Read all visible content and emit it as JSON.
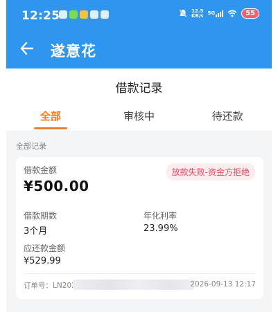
{
  "status_bar": {
    "time": "12:25",
    "net_speed_value": "12.5",
    "net_speed_unit": "KB/s",
    "network": "5G",
    "battery": "55"
  },
  "app_bar": {
    "title": "遂意花"
  },
  "page": {
    "title": "借款记录"
  },
  "tabs": [
    {
      "label": "全部",
      "active": true
    },
    {
      "label": "审核中",
      "active": false
    },
    {
      "label": "待还款",
      "active": false
    }
  ],
  "section_label": "全部记录",
  "record": {
    "amount_label": "借款金额",
    "amount": "¥500.00",
    "status_badge": "放款失败-资金方拒绝",
    "term_label": "借款期数",
    "term": "3个月",
    "rate_label": "年化利率",
    "rate": "23.99%",
    "repay_label": "应还款金额",
    "repay": "¥529.99",
    "order_label": "订单号：",
    "order_prefix": "LN202",
    "order_time": "2026-09-13 12:17"
  },
  "colors": {
    "app_bar": "#2f96f0",
    "accent_orange": "#ff7a1a",
    "badge_text": "#f04a5e",
    "badge_bg": "#ffecef"
  }
}
